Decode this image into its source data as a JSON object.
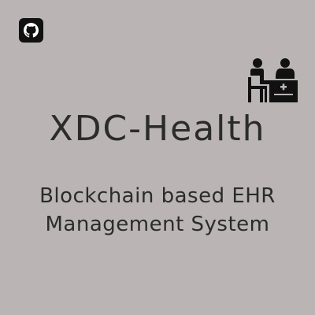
{
  "header": {
    "github_icon": "github-icon",
    "illustration_icon": "doctor-patient-consultation-icon"
  },
  "main": {
    "title": "XDC-Health",
    "tagline_line1": "Blockchain based EHR",
    "tagline_line2": "Management System"
  },
  "colors": {
    "background": "#bab4b5",
    "text": "#2b2b2b",
    "badge": "#111111",
    "icon": "#111111"
  }
}
